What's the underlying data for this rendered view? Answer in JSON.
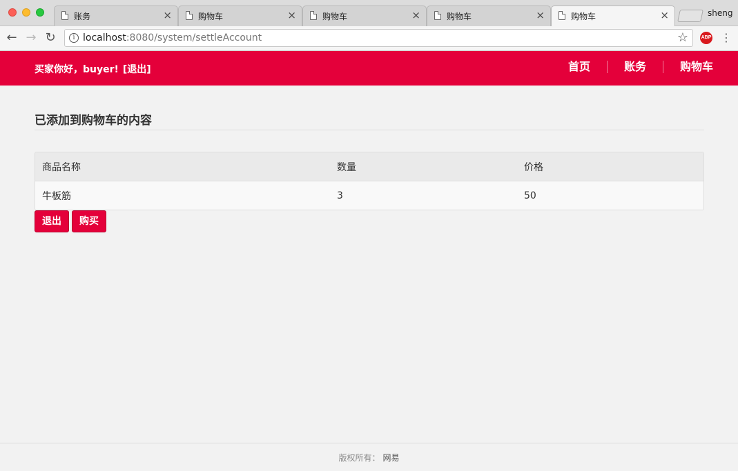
{
  "browser": {
    "tabs": [
      {
        "title": "账务",
        "active": false
      },
      {
        "title": "购物车",
        "active": false
      },
      {
        "title": "购物车",
        "active": false
      },
      {
        "title": "购物车",
        "active": false
      },
      {
        "title": "购物车",
        "active": true
      }
    ],
    "profile_name": "sheng",
    "url_host": "localhost",
    "url_rest": ":8080/system/settleAccount",
    "close_glyph": "×",
    "abp_label": "ABP"
  },
  "header": {
    "greeting": "买家你好，buyer!",
    "logout_link": "[退出]",
    "nav": [
      "首页",
      "账务",
      "购物车"
    ],
    "brand_color": "#e4003a"
  },
  "main": {
    "section_title": "已添加到购物车的内容",
    "table": {
      "columns": [
        "商品名称",
        "数量",
        "价格"
      ],
      "rows": [
        [
          "牛板筋",
          "3",
          "50"
        ]
      ]
    },
    "buttons": {
      "exit_label": "退出",
      "buy_label": "购买"
    }
  },
  "footer": {
    "label": "版权所有：",
    "company": "网易"
  }
}
